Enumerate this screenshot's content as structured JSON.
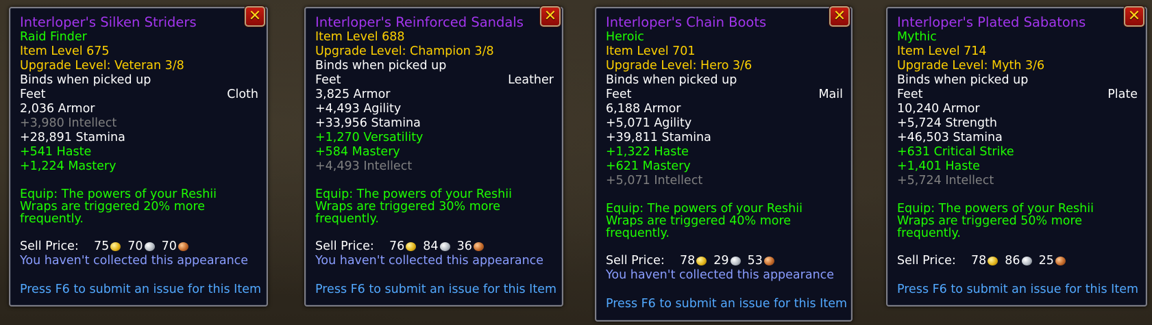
{
  "tooltips": [
    {
      "name": "Interloper's Silken Striders",
      "difficulty": "Raid Finder",
      "item_level": "Item Level 675",
      "upgrade": "Upgrade Level: Veteran 3/8",
      "binds": "Binds when picked up",
      "slot": "Feet",
      "armor_type": "Cloth",
      "stats": [
        {
          "text": "2,036 Armor",
          "color": "white"
        },
        {
          "text": "+3,980 Intellect",
          "color": "gray"
        },
        {
          "text": "+28,891 Stamina",
          "color": "white"
        },
        {
          "text": "+541 Haste",
          "color": "green"
        },
        {
          "text": "+1,224 Mastery",
          "color": "green"
        }
      ],
      "equip": "Equip: The powers of your Reshii Wraps are triggered 20% more frequently.",
      "sell_label": "Sell Price:",
      "gold": "75",
      "silver": "70",
      "copper": "70",
      "appearance": "You haven't collected this appearance",
      "submit": "Press F6 to submit an issue for this Item"
    },
    {
      "name": "Interloper's Reinforced Sandals",
      "difficulty": "",
      "item_level": "Item Level 688",
      "upgrade": "Upgrade Level: Champion 3/8",
      "binds": "Binds when picked up",
      "slot": "Feet",
      "armor_type": "Leather",
      "stats": [
        {
          "text": "3,825 Armor",
          "color": "white"
        },
        {
          "text": "+4,493 Agility",
          "color": "white"
        },
        {
          "text": "+33,956 Stamina",
          "color": "white"
        },
        {
          "text": "+1,270 Versatility",
          "color": "green"
        },
        {
          "text": "+584 Mastery",
          "color": "green"
        },
        {
          "text": "+4,493 Intellect",
          "color": "gray"
        }
      ],
      "equip": "Equip: The powers of your Reshii Wraps are triggered 30% more frequently.",
      "sell_label": "Sell Price:",
      "gold": "76",
      "silver": "84",
      "copper": "36",
      "appearance": "You haven't collected this appearance",
      "submit": "Press F6 to submit an issue for this Item"
    },
    {
      "name": "Interloper's Chain Boots",
      "difficulty": "Heroic",
      "item_level": "Item Level 701",
      "upgrade": "Upgrade Level: Hero 3/6",
      "binds": "Binds when picked up",
      "slot": "Feet",
      "armor_type": "Mail",
      "stats": [
        {
          "text": "6,188 Armor",
          "color": "white"
        },
        {
          "text": "+5,071 Agility",
          "color": "white"
        },
        {
          "text": "+39,811 Stamina",
          "color": "white"
        },
        {
          "text": "+1,322 Haste",
          "color": "green"
        },
        {
          "text": "+621 Mastery",
          "color": "green"
        },
        {
          "text": "+5,071 Intellect",
          "color": "gray"
        }
      ],
      "equip": "Equip: The powers of your Reshii Wraps are triggered 40% more frequently.",
      "sell_label": "Sell Price:",
      "gold": "78",
      "silver": "29",
      "copper": "53",
      "appearance": "You haven't collected this appearance",
      "submit": "Press F6 to submit an issue for this Item"
    },
    {
      "name": "Interloper's Plated Sabatons",
      "difficulty": "Mythic",
      "item_level": "Item Level 714",
      "upgrade": "Upgrade Level: Myth 3/6",
      "binds": "Binds when picked up",
      "slot": "Feet",
      "armor_type": "Plate",
      "stats": [
        {
          "text": "10,240 Armor",
          "color": "white"
        },
        {
          "text": "+5,724 Strength",
          "color": "white"
        },
        {
          "text": "+46,503 Stamina",
          "color": "white"
        },
        {
          "text": "+631 Critical Strike",
          "color": "green"
        },
        {
          "text": "+1,401 Haste",
          "color": "green"
        },
        {
          "text": "+5,724 Intellect",
          "color": "gray"
        }
      ],
      "equip": "Equip: The powers of your Reshii Wraps are triggered 50% more frequently.",
      "sell_label": "Sell Price:",
      "gold": "78",
      "silver": "86",
      "copper": "25",
      "appearance": "",
      "submit": "Press F6 to submit an issue for this Item"
    }
  ],
  "close_glyph": "✕"
}
